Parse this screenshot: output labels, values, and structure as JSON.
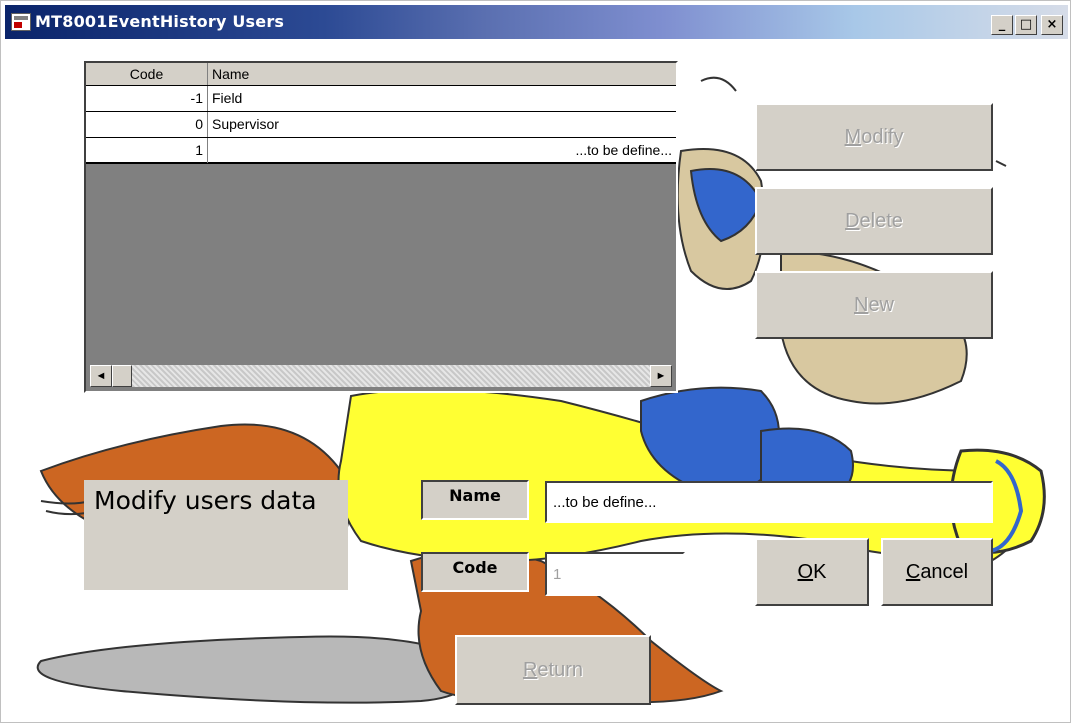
{
  "window": {
    "title": "MT8001EventHistory Users",
    "controls": [
      "_",
      "□",
      "×"
    ]
  },
  "grid": {
    "columns": [
      "Code",
      "Name"
    ],
    "rows": [
      {
        "code": "-1",
        "name": "Field"
      },
      {
        "code": "0",
        "name": "Supervisor"
      },
      {
        "code": "1",
        "name": "...to be define..."
      }
    ],
    "scroll_left": "◄",
    "scroll_right": "►"
  },
  "buttons": {
    "modify": {
      "pre": "",
      "accel": "M",
      "post": "odify"
    },
    "delete": {
      "pre": "",
      "accel": "D",
      "post": "elete"
    },
    "new": {
      "pre": "",
      "accel": "N",
      "post": "ew"
    },
    "ok": {
      "pre": "",
      "accel": "O",
      "post": "K"
    },
    "cancel": {
      "pre": "",
      "accel": "C",
      "post": "ancel"
    },
    "return": {
      "pre": "",
      "accel": "R",
      "post": "eturn"
    }
  },
  "form": {
    "heading": "Modify users data",
    "name_label": "Name",
    "name_value": "...to be define...",
    "code_label": "Code",
    "code_value": "1"
  },
  "icons": {
    "app": "app-window-icon",
    "minimize": "minimize-icon",
    "maximize": "maximize-icon",
    "close": "close-icon",
    "scroll_left": "arrow-left-icon",
    "scroll_right": "arrow-right-icon"
  },
  "colors": {
    "titlebar_start": "#0a246a",
    "face": "#d4d0c8",
    "grid_bg": "#808080",
    "cartoon_yellow": "#ffff33",
    "cartoon_blue": "#3366cc",
    "cartoon_orange": "#cc6622",
    "cartoon_skin": "#d8c8a0",
    "shadow_gray": "#b8b8b8"
  }
}
